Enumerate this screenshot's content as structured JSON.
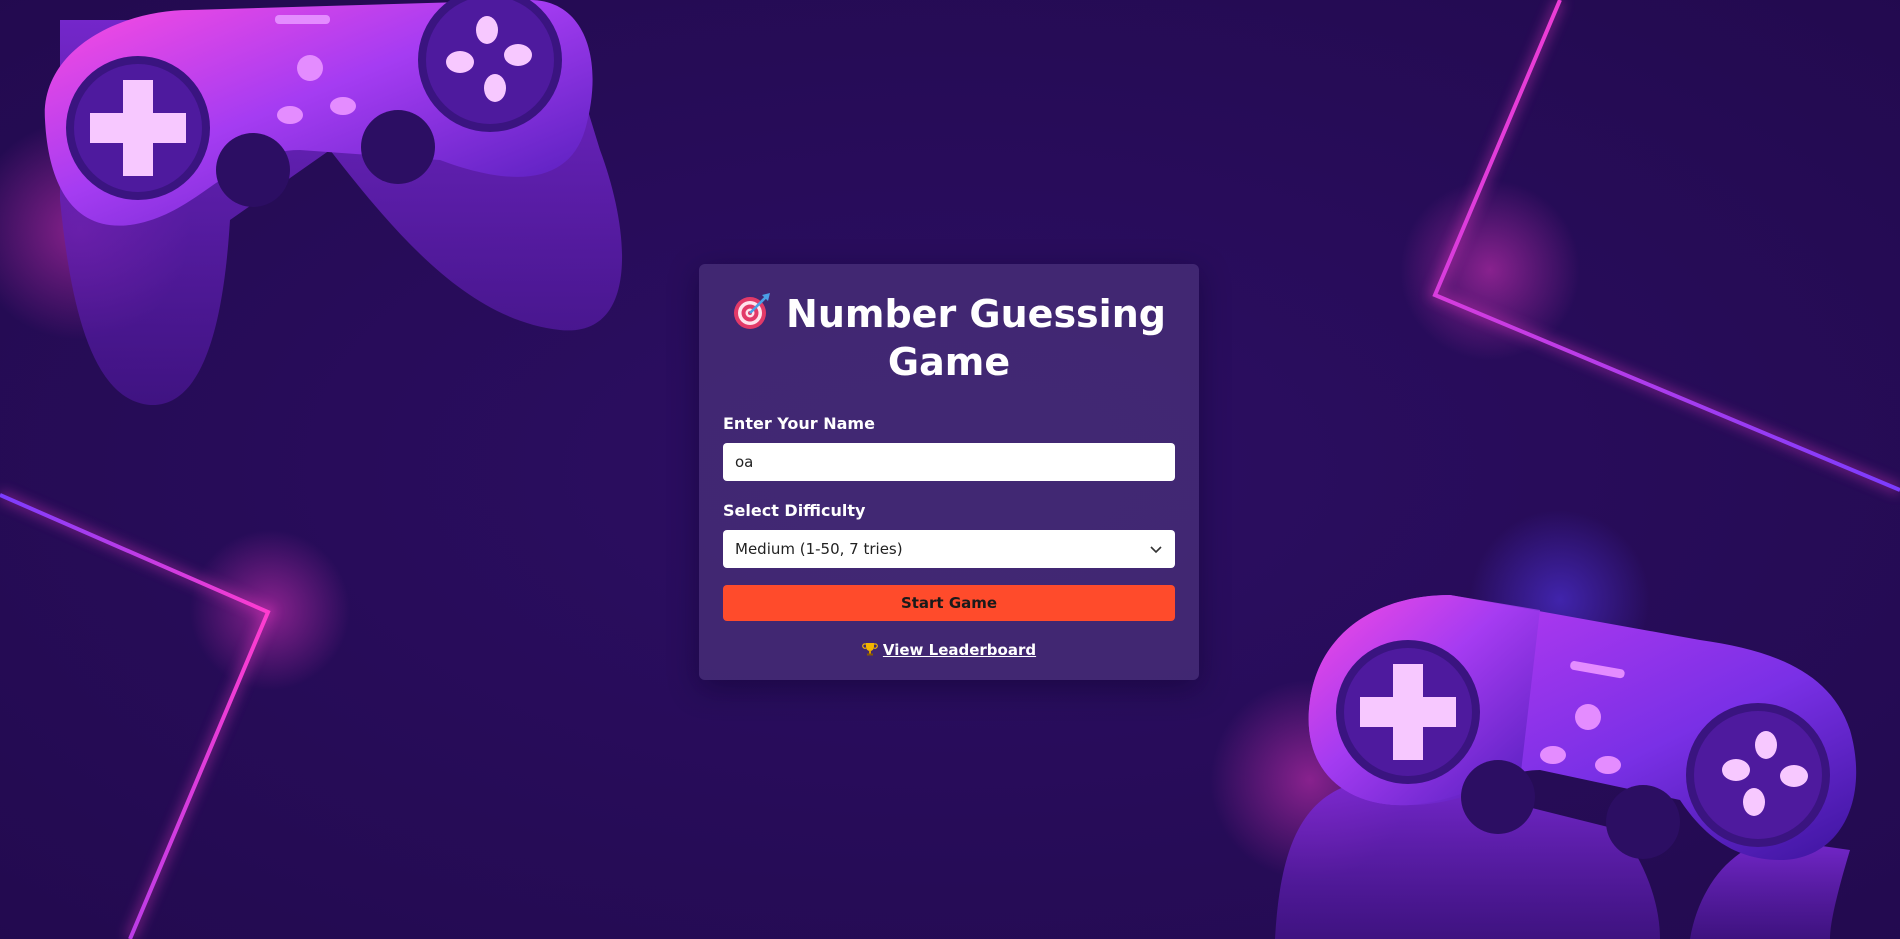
{
  "app": {
    "title": "Number Guessing Game",
    "title_icon": "target-dart-icon"
  },
  "form": {
    "name_label": "Enter Your Name",
    "name_value": "oa",
    "difficulty_label": "Select Difficulty",
    "difficulty_selected": "Medium (1-50, 7 tries)",
    "start_label": "Start Game",
    "leaderboard_label": "View Leaderboard",
    "leaderboard_icon": "trophy-icon"
  },
  "colors": {
    "background": "#2a0d5c",
    "card": "#483078",
    "accent_button": "#ff4b2b",
    "neon_pink": "#ff3fd0",
    "neon_violet": "#8a3cff"
  }
}
